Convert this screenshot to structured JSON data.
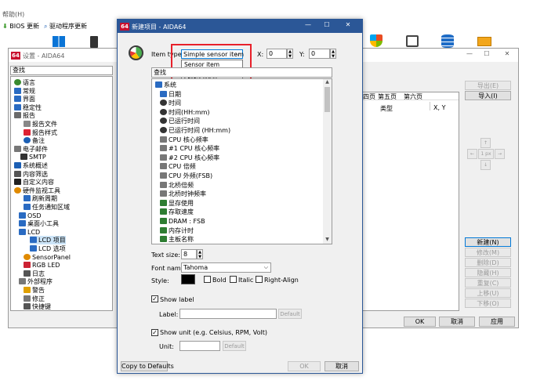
{
  "top_bar": {
    "help_menu": "帮助(H)",
    "bios_update": "BIOS 更新",
    "driver_update": "驱动程序更新"
  },
  "settings_window": {
    "title": "设置 - AIDA64",
    "app_icon": "64",
    "search_label": "查找",
    "tree": [
      {
        "label": "语言",
        "icon": "globe-icon"
      },
      {
        "label": "常规",
        "icon": "gear-icon"
      },
      {
        "label": "界面",
        "icon": "window-icon"
      },
      {
        "label": "稳定性",
        "icon": "check-icon"
      },
      {
        "label": "报告",
        "icon": "document-icon"
      },
      {
        "label": "报告文件",
        "icon": "document-icon"
      },
      {
        "label": "报告样式",
        "icon": "check-icon"
      },
      {
        "label": "备注",
        "icon": "info-icon"
      },
      {
        "label": "电子邮件",
        "icon": "mail-icon"
      },
      {
        "label": "SMTP",
        "icon": "server-icon"
      },
      {
        "label": "系统概述",
        "icon": "monitor-icon"
      },
      {
        "label": "内容筛选",
        "icon": "filter-icon"
      },
      {
        "label": "自定义内容",
        "icon": "box-icon"
      },
      {
        "label": "硬件监视工具",
        "icon": "gauge-icon"
      },
      {
        "label": "刷新周期",
        "icon": "clock-icon"
      },
      {
        "label": "任务通知区域",
        "icon": "tray-icon"
      },
      {
        "label": "OSD",
        "icon": "osd-icon"
      },
      {
        "label": "桌面小工具",
        "icon": "gadget-icon"
      },
      {
        "label": "LCD",
        "icon": "lcd-icon"
      },
      {
        "label": "LCD 项目",
        "icon": "lcd-icon"
      },
      {
        "label": "LCD 选项",
        "icon": "lcd-icon"
      },
      {
        "label": "SensorPanel",
        "icon": "gauge-icon"
      },
      {
        "label": "RGB LED",
        "icon": "rgb-icon"
      },
      {
        "label": "日志",
        "icon": "log-icon"
      },
      {
        "label": "外部程序",
        "icon": "program-icon"
      },
      {
        "label": "警告",
        "icon": "warning-icon"
      },
      {
        "label": "修正",
        "icon": "fix-icon"
      },
      {
        "label": "快捷键",
        "icon": "key-icon"
      }
    ],
    "pages": [
      "第四页",
      "第五页",
      "第六页"
    ],
    "columns": [
      "类型",
      "X, Y"
    ],
    "side_buttons": [
      {
        "label": "导出(E)",
        "disabled": true
      },
      {
        "label": "导入(I)",
        "disabled": false
      }
    ],
    "arrows": {
      "up": "↑",
      "left": "←",
      "mid": "1 px",
      "right": "→",
      "down": "↓"
    },
    "item_buttons": [
      {
        "label": "新建(N)",
        "disabled": false
      },
      {
        "label": "修改(M)",
        "disabled": true
      },
      {
        "label": "删除(D)",
        "disabled": true
      },
      {
        "label": "隐藏(H)",
        "disabled": true
      },
      {
        "label": "重复(C)",
        "disabled": true
      },
      {
        "label": "上移(U)",
        "disabled": true
      },
      {
        "label": "下移(O)",
        "disabled": true
      }
    ],
    "ok": "OK",
    "cancel": "取消",
    "apply": "应用"
  },
  "dialog": {
    "title": "新建项目 - AIDA64",
    "app_icon": "64",
    "item_type_label": "Item type:",
    "item_type_value": "Simple sensor item",
    "item_type_options": [
      "Sensor item",
      "Simple sensor item",
      "Static label",
      "Image",
      "Graph",
      "Arc Gauge"
    ],
    "x_label": "X:",
    "x_value": "0",
    "y_label": "Y:",
    "y_value": "0",
    "search_label": "查找",
    "sensor_tree": [
      "系统",
      "日期",
      "时间",
      "时间(HH:mm)",
      "已运行时间",
      "已运行时间 (HH:mm)",
      "CPU 核心频率",
      "#1 CPU 核心频率",
      "#2 CPU 核心频率",
      "CPU 倍频",
      "CPU 外频(FSB)",
      "北桥倍频",
      "北桥时钟频率",
      "显存使用",
      "存取速度",
      "DRAM : FSB",
      "内存计时",
      "主板名称"
    ],
    "text_size_label": "Text size:",
    "text_size_value": "8",
    "font_name_label": "Font name:",
    "font_name_value": "Tahoma",
    "style_label": "Style:",
    "bold_label": "Bold",
    "italic_label": "Italic",
    "right_align_label": "Right-Align",
    "show_label_label": "Show label",
    "label_label": "Label:",
    "label_default": "Default",
    "show_unit_label": "Show unit (e.g. Celsius, RPM, Volt)",
    "unit_label": "Unit:",
    "unit_default": "Default",
    "copy_defaults": "Copy to Defaults",
    "ok": "OK",
    "cancel": "取消",
    "colors": {
      "titlebar": "#2b5797",
      "highlight": "#0078d7",
      "red_box": "#e8202a"
    }
  }
}
